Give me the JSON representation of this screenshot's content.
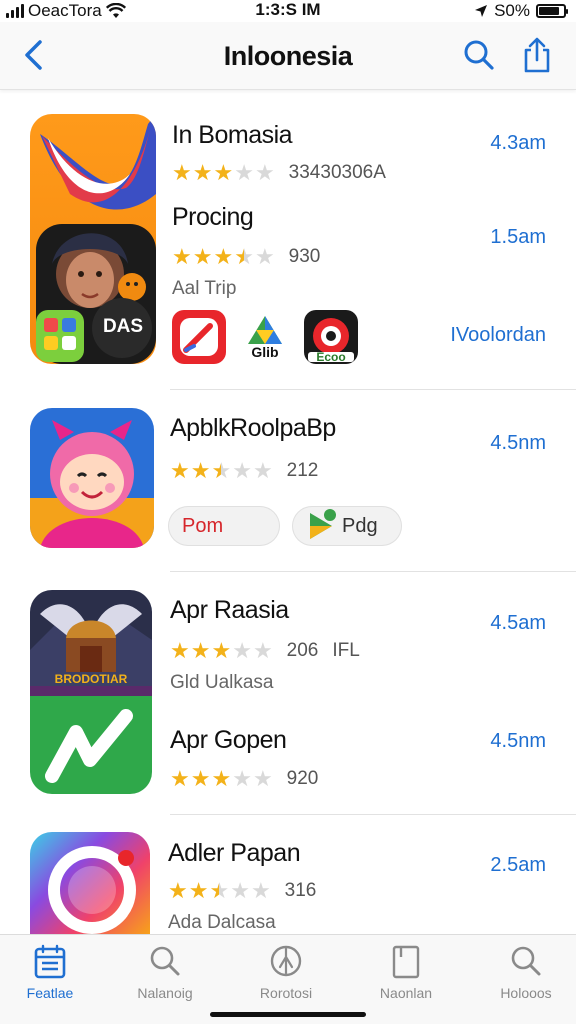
{
  "status": {
    "carrier": "OeacTora",
    "time": "1:3:S IM",
    "battery": "S0%",
    "battery_level": 0.85
  },
  "nav": {
    "title": "Inloonesia"
  },
  "apps": [
    {
      "name": "In Bomasia",
      "rating": 3,
      "meta": "33430306A",
      "size": "4.3am"
    },
    {
      "name": "Procing",
      "rating": 3.5,
      "meta": "930",
      "sub": "Aal Trip",
      "size": "1.5am",
      "badge": "DAS",
      "extras": [
        "",
        "Glib",
        "Ecoo"
      ],
      "link": "IVoolordan"
    },
    {
      "name": "ApblkRoolpaBp",
      "rating": 2.5,
      "meta": "212",
      "size": "4.5nm",
      "pills": [
        "Pom",
        "Pdg"
      ]
    },
    {
      "name": "Apr Raasia",
      "rating": 3,
      "meta": "206",
      "meta2": "IFL",
      "sub": "Gld Ualkasa",
      "size": "4.5am",
      "banner": "BRODOTIAR"
    },
    {
      "name": "Apr Gopen",
      "rating": 3,
      "meta": "920",
      "size": "4.5nm"
    },
    {
      "name": "Adler Papan",
      "rating": 2.5,
      "meta": "316",
      "sub": "Ada Dalcasa",
      "size": "2.5am"
    }
  ],
  "tabs": [
    {
      "label": "Featlae",
      "icon": "featured-icon",
      "active": true
    },
    {
      "label": "Nalanoig",
      "icon": "search-icon",
      "active": false
    },
    {
      "label": "Rorotosi",
      "icon": "compass-icon",
      "active": false
    },
    {
      "label": "Naonlan",
      "icon": "book-icon",
      "active": false
    },
    {
      "label": "Holooos",
      "icon": "search-icon",
      "active": false
    }
  ],
  "colors": {
    "accent": "#1f6fd1",
    "star": "#f3b21a",
    "star_empty": "#d9d9d9"
  }
}
